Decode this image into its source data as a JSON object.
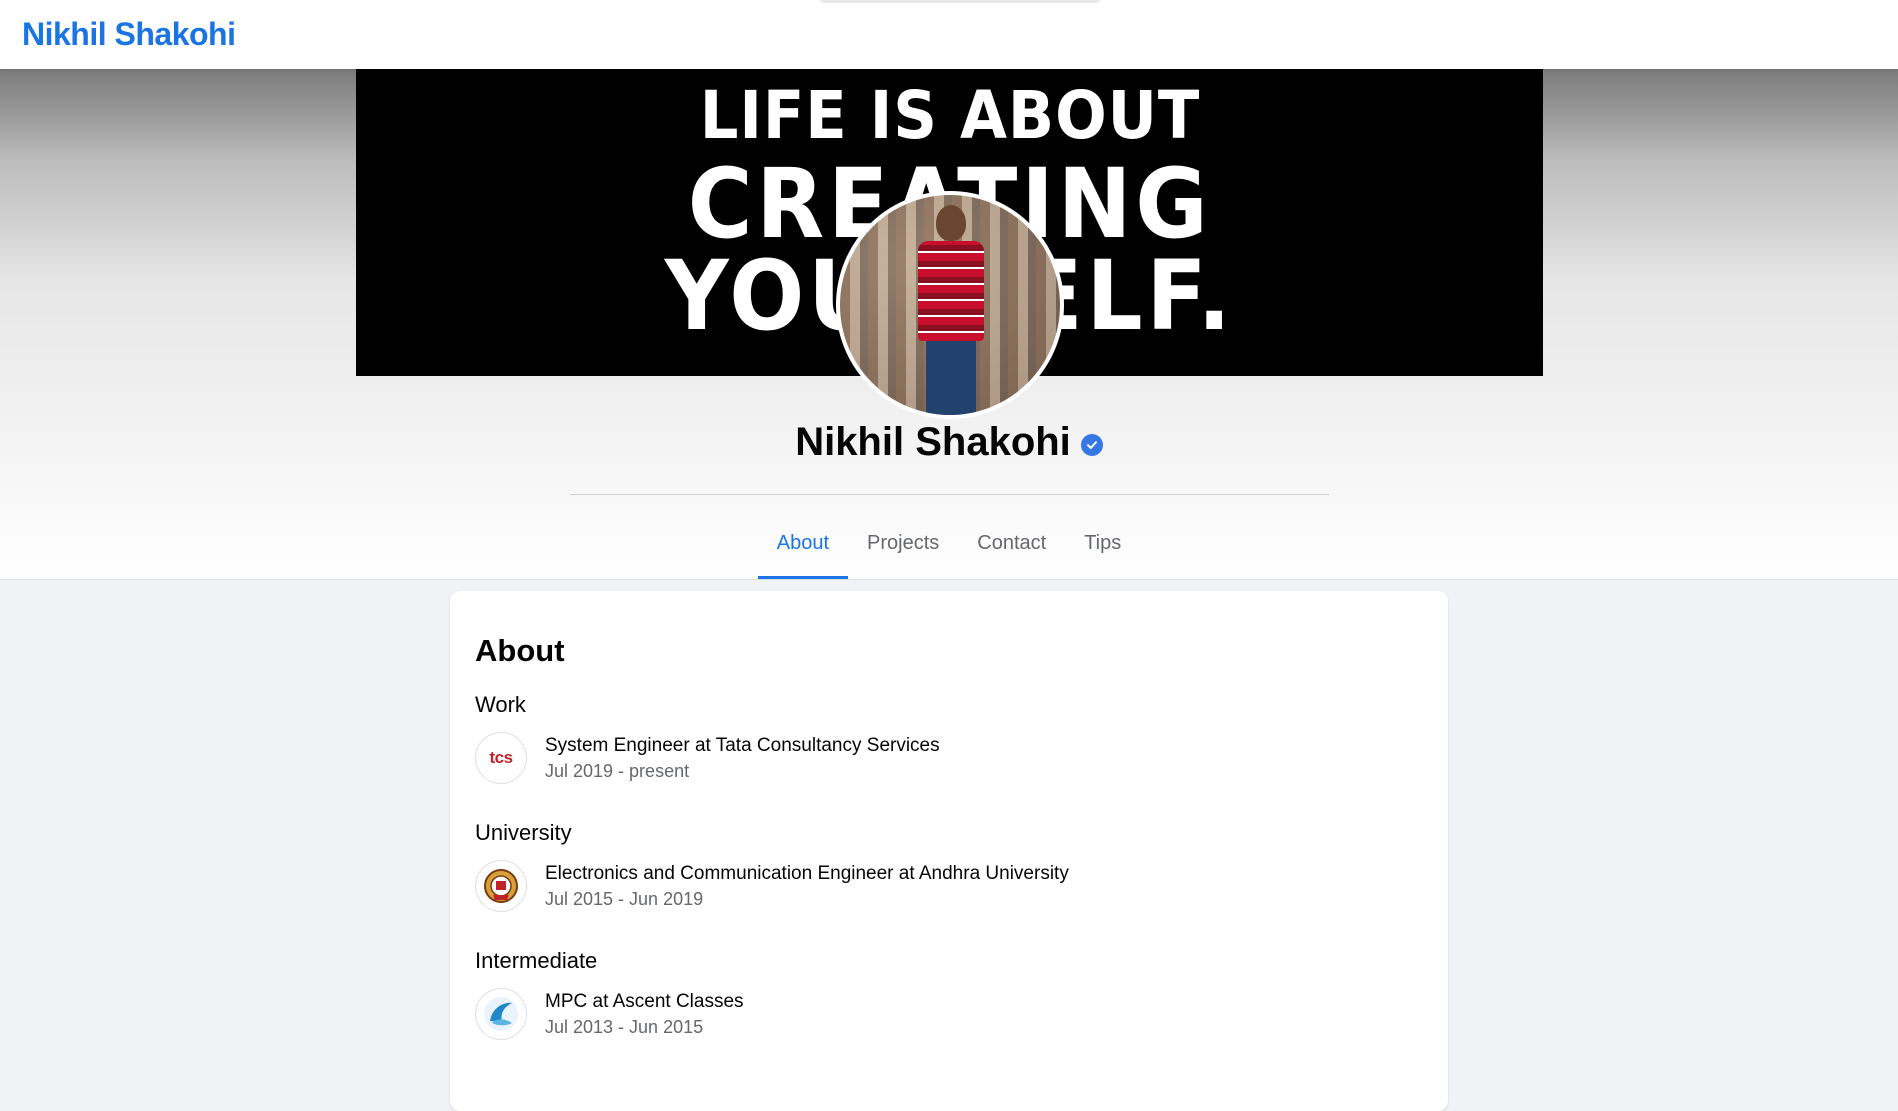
{
  "navbar": {
    "brand": "Nikhil Shakohi"
  },
  "cover": {
    "line1": "LIFE IS ABOUT",
    "line2": "CREATING",
    "line3": "YOURSELF."
  },
  "profile": {
    "name": "Nikhil Shakohi",
    "verified_icon": "check-icon"
  },
  "tabs": [
    {
      "label": "About",
      "active": true
    },
    {
      "label": "Projects",
      "active": false
    },
    {
      "label": "Contact",
      "active": false
    },
    {
      "label": "Tips",
      "active": false
    }
  ],
  "about": {
    "title": "About",
    "sections": [
      {
        "heading": "Work",
        "title": "System Engineer at Tata Consultancy Services",
        "date": "Jul 2019 - present",
        "logo": "tcs-logo",
        "logo_text": "tcs"
      },
      {
        "heading": "University",
        "title": "Electronics and Communication Engineer at Andhra University",
        "date": "Jul 2015 - Jun 2019",
        "logo": "andhra-university-emblem"
      },
      {
        "heading": "Intermediate",
        "title": "MPC at Ascent Classes",
        "date": "Jul 2013 - Jun 2015",
        "logo": "ascent-classes-logo"
      }
    ]
  },
  "colors": {
    "accent": "#1b74e4",
    "verified": "#3578e5",
    "page_bg": "#f0f2f5"
  }
}
